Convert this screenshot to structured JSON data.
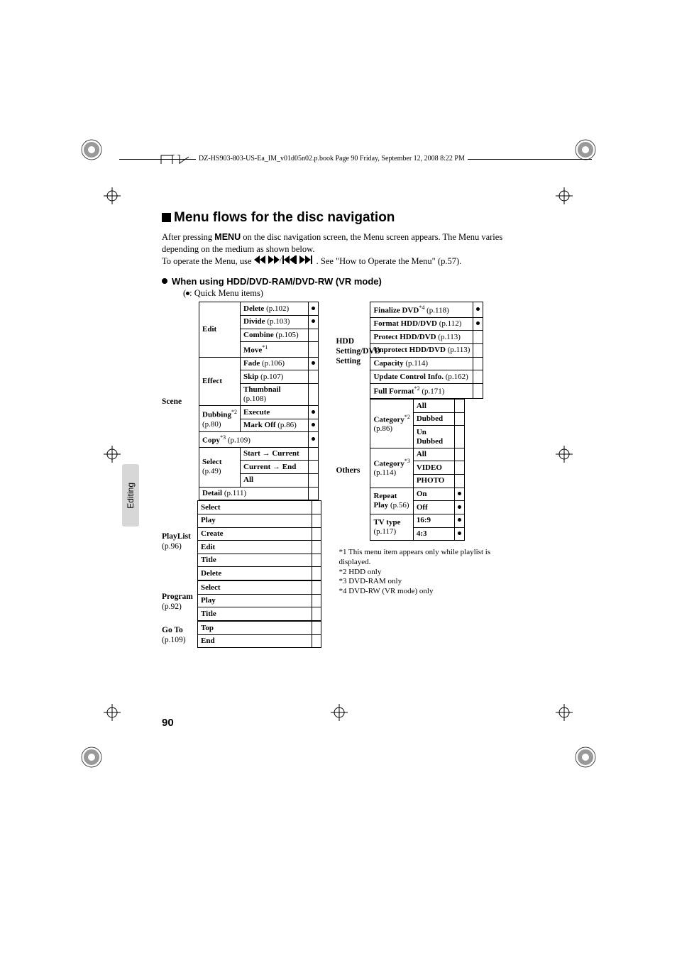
{
  "header": {
    "running_head": "DZ-HS903-803-US-Ea_IM_v01d05n02.p.book  Page 90  Friday, September 12, 2008  8:22 PM"
  },
  "title": "Menu flows for the disc navigation",
  "intro": {
    "line1a": "After pressing ",
    "menu_word": "MENU",
    "line1b": " on the disc navigation screen, the Menu screen appears. The Menu varies depending on the medium as shown below.",
    "line2a": "To operate the Menu, use ",
    "line2b": ". See \"How to Operate the Menu\" (p.57)."
  },
  "mode_heading": "When using HDD/DVD-RAM/DVD-RW (VR mode)",
  "quick_legend": ": Quick Menu items)",
  "side_tab": "Editing",
  "page_number": "90",
  "left": {
    "scene": {
      "label": "Scene",
      "edit": {
        "label": "Edit",
        "rows": [
          {
            "label_b": "Delete",
            "label_p": " (p.102)",
            "dot": true
          },
          {
            "label_b": "Divide",
            "label_p": " (p.103)",
            "dot": true
          },
          {
            "label_b": "Combine",
            "label_p": " (p.105)",
            "dot": false
          },
          {
            "label_b": "Move",
            "sup": "*1",
            "dot": false
          }
        ]
      },
      "effect": {
        "label": "Effect",
        "rows": [
          {
            "label_b": "Fade",
            "label_p": " (p.106)",
            "dot": true
          },
          {
            "label_b": "Skip",
            "label_p": " (p.107)",
            "dot": false
          },
          {
            "label_b": "Thumbnail",
            "label_p2": "(p.108)",
            "dot": false
          }
        ]
      },
      "dubbing": {
        "label_b": "Dubbing",
        "sup": "*2",
        "sub": "(p.80)",
        "rows": [
          {
            "label_b": "Execute",
            "dot": true
          },
          {
            "label_b": "Mark Off",
            "label_p": " (p.86)",
            "dot": true
          }
        ]
      },
      "copy": {
        "label_b": "Copy",
        "sup": "*3",
        "label_p": " (p.109)",
        "dot": true
      },
      "select": {
        "label_b": "Select",
        "sub": "(p.49)",
        "rows": [
          {
            "text": "Start → Current"
          },
          {
            "text": "Current → End"
          },
          {
            "text": "All"
          }
        ]
      },
      "detail": {
        "label_b": "Detail",
        "label_p": " (p.111)"
      }
    },
    "playlist": {
      "label": "PlayList",
      "sub": "(p.96)",
      "rows": [
        "Select",
        "Play",
        "Create",
        "Edit",
        "Title",
        "Delete"
      ]
    },
    "program": {
      "label": "Program",
      "sub": "(p.92)",
      "rows": [
        "Select",
        "Play",
        "Title"
      ]
    },
    "goto": {
      "label": "Go To",
      "sub": "(p.109)",
      "rows": [
        "Top",
        "End"
      ]
    }
  },
  "right": {
    "hdd": {
      "label": "HDD Setting/DVD Setting",
      "rows": [
        {
          "label_b": "Finalize DVD",
          "sup": "*4",
          "label_p": " (p.118)",
          "dot": true
        },
        {
          "label_b": "Format HDD/DVD",
          "label_p": " (p.112)",
          "dot": true
        },
        {
          "label_b": "Protect HDD/DVD",
          "label_p": " (p.113)",
          "dot": false
        },
        {
          "label_b": "Unprotect HDD/DVD",
          "label_p": " (p.113)",
          "dot": false
        },
        {
          "label_b": "Capacity",
          "label_p": " (p.114)",
          "dot": false
        },
        {
          "label_b": "Update Control Info.",
          "label_p": " (p.162)",
          "dot": false
        },
        {
          "label_b": "Full Format",
          "sup": "*2",
          "label_p": " (p.171)",
          "dot": false
        }
      ]
    },
    "others": {
      "label": "Others",
      "cat1": {
        "label_b": "Category",
        "sup": "*2",
        "sub": "(p.86)",
        "rows": [
          "All",
          "Dubbed",
          "Un Dubbed"
        ]
      },
      "cat2": {
        "label_b": "Category",
        "sup": "*3",
        "sub": "(p.114)",
        "rows": [
          "All",
          "VIDEO",
          "PHOTO"
        ]
      },
      "repeat": {
        "label_b": "Repeat Play",
        "label_p": " (p.56)",
        "rows": [
          {
            "text": "On",
            "dot": true
          },
          {
            "text": "Off",
            "dot": true
          }
        ]
      },
      "tv": {
        "label_b": "TV type",
        "sub": "(p.117)",
        "rows": [
          {
            "text": "16:9",
            "dot": true
          },
          {
            "text": "4:3",
            "dot": true
          }
        ]
      }
    }
  },
  "notes": {
    "n1": "*1  This menu item appears only while playlist is displayed.",
    "n2": "*2  HDD only",
    "n3": "*3  DVD-RAM only",
    "n4": "*4  DVD-RW (VR mode) only"
  }
}
